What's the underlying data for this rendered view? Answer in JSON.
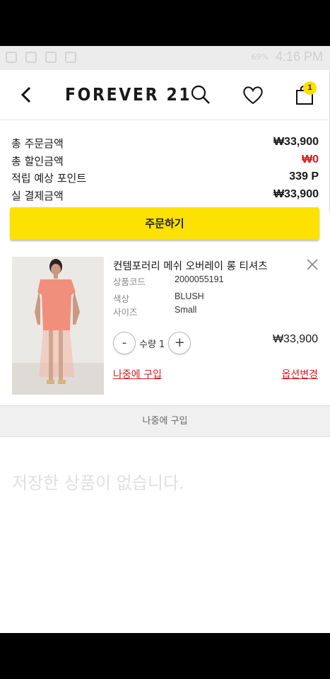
{
  "status": {
    "time": "4:16 PM",
    "battery": "69%"
  },
  "header": {
    "logo": "FOREVER 21",
    "cart_count": "1"
  },
  "summary": {
    "rows": [
      {
        "label": "총 주문금액",
        "value": "₩33,900"
      },
      {
        "label": "총 할인금액",
        "value": "₩0"
      },
      {
        "label": "적립 예상 포인트",
        "value": "339 P"
      },
      {
        "label": "실 결제금액",
        "value": "₩33,900"
      }
    ]
  },
  "order_button": "주문하기",
  "item": {
    "name": "컨템포러리 메쉬 오버레이 롱 티셔츠",
    "code_label": "상품코드",
    "code_value": "2000055191",
    "color_label": "색상",
    "color_value": "BLUSH",
    "size_label": "사이즈",
    "size_value": "Small",
    "minus": "-",
    "qty_text": "수량 1",
    "plus": "+",
    "price": "₩33,900",
    "buy_later": "나중에 구입",
    "change_option": "옵션변경",
    "dress_color": "#f0907c"
  },
  "saved": {
    "title": "나중에 구입",
    "empty_message": "저장한 상품이 없습니다."
  },
  "colors": {
    "accent": "#fde100",
    "red": "#d21f1f"
  }
}
